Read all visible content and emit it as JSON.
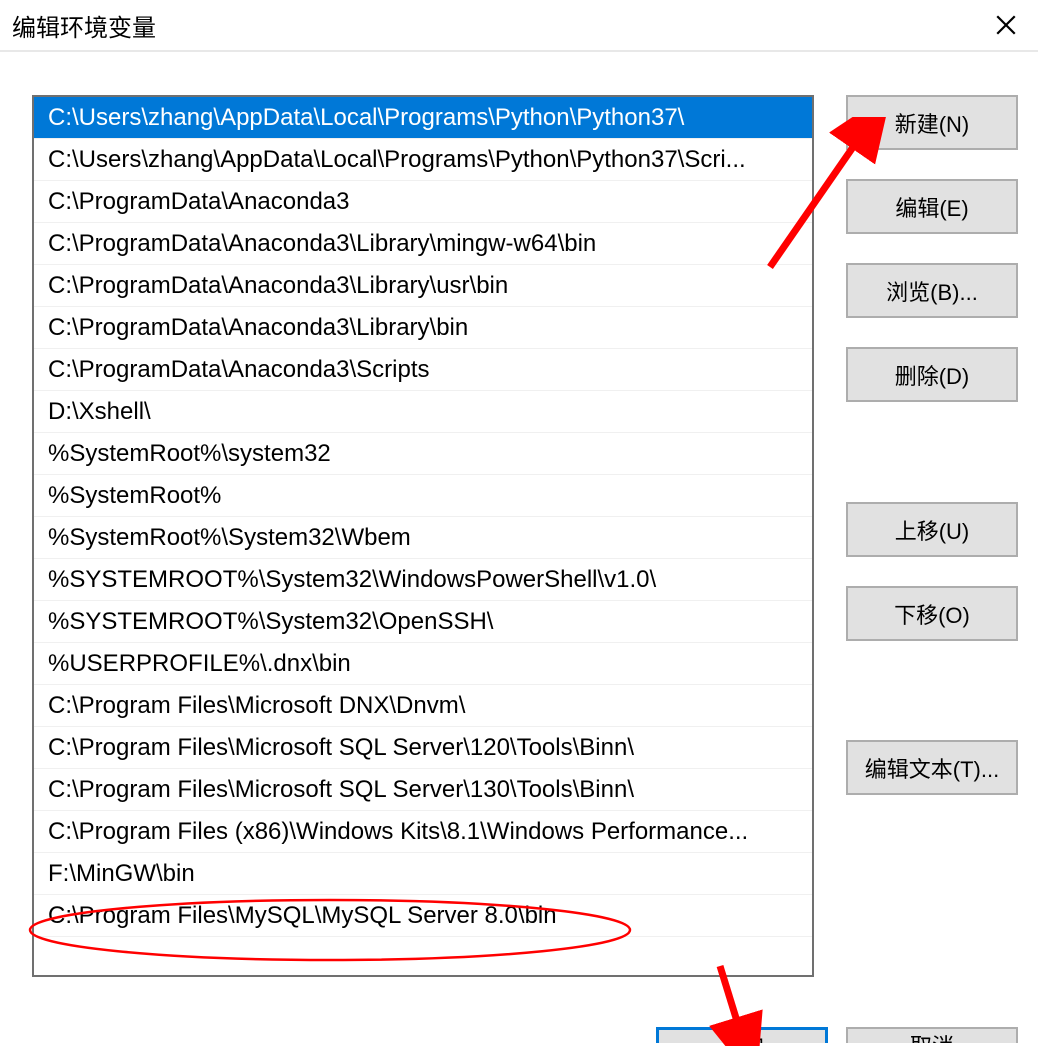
{
  "title": "编辑环境变量",
  "paths": [
    "C:\\Users\\zhang\\AppData\\Local\\Programs\\Python\\Python37\\",
    "C:\\Users\\zhang\\AppData\\Local\\Programs\\Python\\Python37\\Scri...",
    "C:\\ProgramData\\Anaconda3",
    "C:\\ProgramData\\Anaconda3\\Library\\mingw-w64\\bin",
    "C:\\ProgramData\\Anaconda3\\Library\\usr\\bin",
    "C:\\ProgramData\\Anaconda3\\Library\\bin",
    "C:\\ProgramData\\Anaconda3\\Scripts",
    "D:\\Xshell\\",
    "%SystemRoot%\\system32",
    "%SystemRoot%",
    "%SystemRoot%\\System32\\Wbem",
    "%SYSTEMROOT%\\System32\\WindowsPowerShell\\v1.0\\",
    "%SYSTEMROOT%\\System32\\OpenSSH\\",
    "%USERPROFILE%\\.dnx\\bin",
    "C:\\Program Files\\Microsoft DNX\\Dnvm\\",
    "C:\\Program Files\\Microsoft SQL Server\\120\\Tools\\Binn\\",
    "C:\\Program Files\\Microsoft SQL Server\\130\\Tools\\Binn\\",
    "C:\\Program Files (x86)\\Windows Kits\\8.1\\Windows Performance...",
    "F:\\MinGW\\bin",
    "C:\\Program Files\\MySQL\\MySQL Server 8.0\\bin"
  ],
  "selected_index": 0,
  "buttons": {
    "new": "新建(N)",
    "edit": "编辑(E)",
    "browse": "浏览(B)...",
    "delete": "删除(D)",
    "move_up": "上移(U)",
    "move_down": "下移(O)",
    "edit_text": "编辑文本(T)...",
    "ok": "确定",
    "cancel": "取消"
  },
  "annotation_color": "#ff0000"
}
